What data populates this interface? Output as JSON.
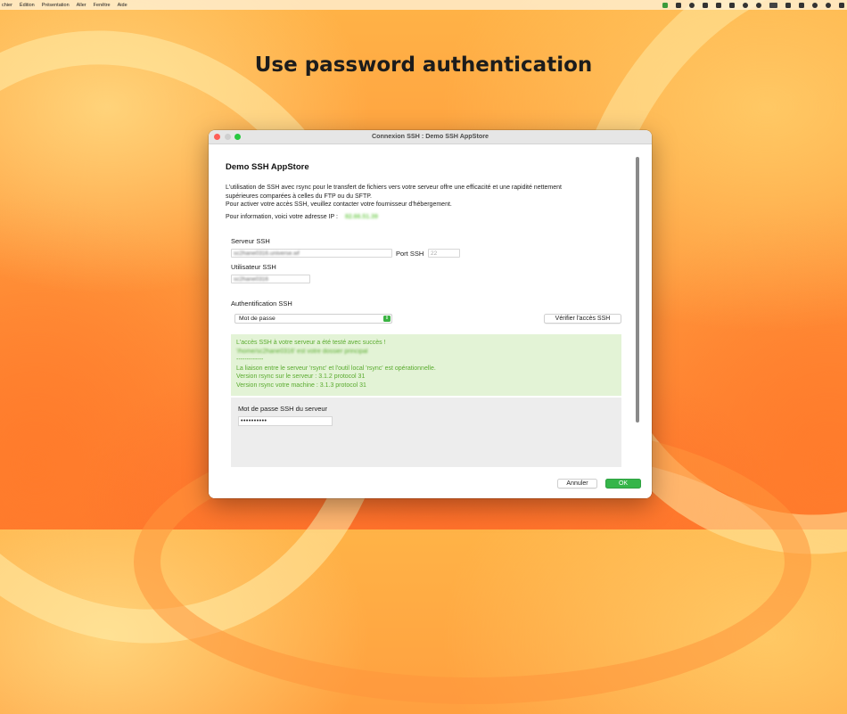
{
  "menubar": {
    "items": [
      "chier",
      "Édition",
      "Présentation",
      "Aller",
      "Fenêtre",
      "Aide"
    ]
  },
  "hero": {
    "title": "Use password authentication"
  },
  "window": {
    "title": "Connexion SSH : Demo SSH AppStore",
    "heading": "Demo SSH AppStore",
    "description": [
      "L'utilisation de SSH avec rsync pour le transfert de fichiers vers votre serveur offre une efficacité et une rapidité nettement",
      "supérieures comparées à celles du FTP ou du SFTP.",
      "Pour activer votre accès SSH, veuillez contacter votre fournisseur d'hébergement."
    ],
    "ip_label": "Pour information, voici votre adresse IP :",
    "ip_value": "82.66.51.39",
    "server": {
      "label": "Serveur SSH",
      "value": "sc2hane0316.universe.wf",
      "port_label": "Port SSH",
      "port_placeholder": "22"
    },
    "user": {
      "label": "Utilisateur SSH",
      "value": "sc2hane0316"
    },
    "auth": {
      "label": "Authentification SSH",
      "selected": "Mot de passe",
      "verify_button": "Vérifier l'accès SSH"
    },
    "success_lines": [
      "L'accès SSH à votre serveur a été testé avec succès !",
      "'/home/sc2hane0316' est votre dossier principal",
      "-------------",
      "La liaison entre le serveur 'rsync' et l'outil local 'rsync' est opérationnelle.",
      "Version rsync sur le serveur : 3.1.2  protocol  31",
      "Version rsync votre machine : 3.1.3  protocol  31"
    ],
    "password": {
      "label": "Mot de passe SSH du serveur",
      "value": "••••••••••"
    },
    "buttons": {
      "cancel": "Annuler",
      "ok": "OK"
    }
  },
  "colors": {
    "accent_green": "#36b54a",
    "success_text": "#5aab2f",
    "success_bg": "#e3f3d6"
  }
}
